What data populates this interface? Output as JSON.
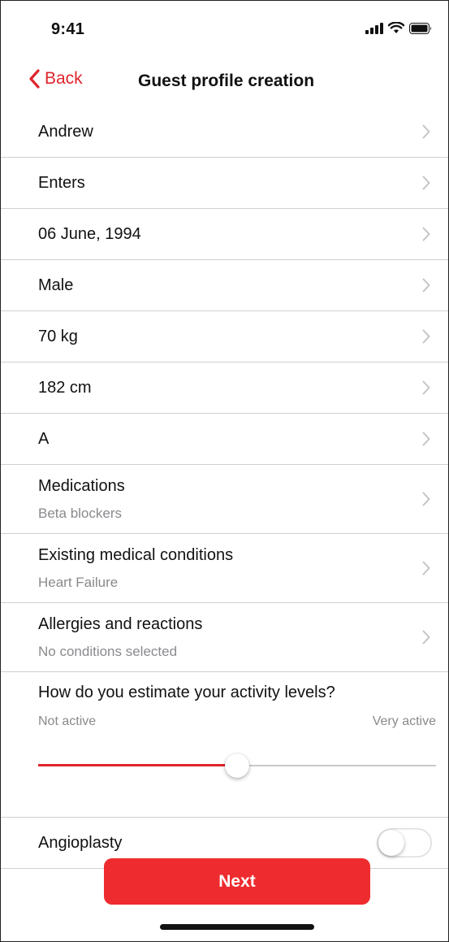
{
  "status_bar": {
    "time": "9:41",
    "icons": [
      "cellular-signal-icon",
      "wifi-icon",
      "battery-icon"
    ]
  },
  "nav": {
    "back_label": "Back",
    "title": "Guest profile creation"
  },
  "rows": [
    {
      "title": "Andrew"
    },
    {
      "title": "Enters"
    },
    {
      "title": "06 June, 1994"
    },
    {
      "title": "Male"
    },
    {
      "title": "70 kg"
    },
    {
      "title": "182 cm"
    },
    {
      "title": "A"
    },
    {
      "title": "Medications",
      "subtitle": "Beta blockers"
    },
    {
      "title": "Existing medical conditions",
      "subtitle": "Heart Failure"
    },
    {
      "title": "Allergies and reactions",
      "subtitle": "No conditions selected"
    }
  ],
  "activity": {
    "question": "How do you estimate your activity levels?",
    "min_label": "Not active",
    "max_label": "Very active",
    "value": 0.5
  },
  "angioplasty": {
    "label": "Angioplasty",
    "on": false
  },
  "next_label": "Next",
  "colors": {
    "accent": "#ee2b2e",
    "back": "#e0242c",
    "secondary_text": "#8a8a8e"
  }
}
